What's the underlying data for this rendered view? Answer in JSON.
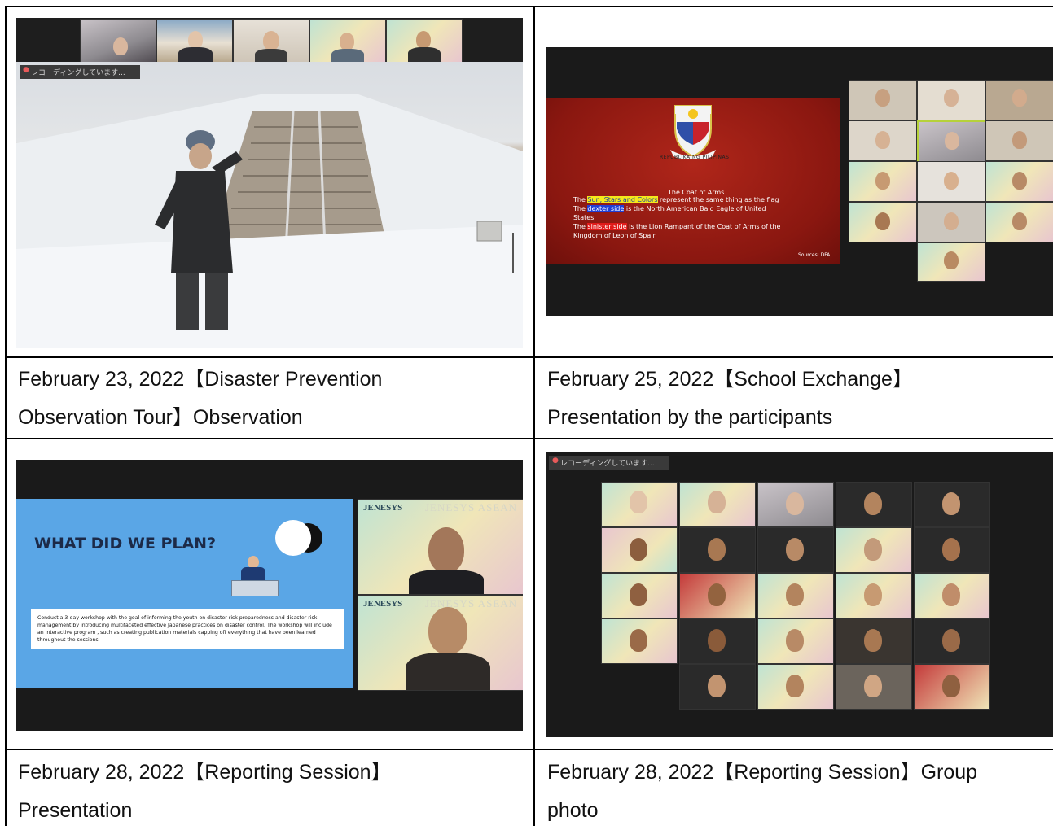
{
  "captions": {
    "c1_line1": "February 23, 2022【Disaster Prevention",
    "c1_line2": "Observation Tour】Observation",
    "c2_line1": "February 25, 2022【School Exchange】",
    "c2_line2": "Presentation by the participants",
    "c3_line1": "February 28, 2022【Reporting Session】",
    "c3_line2": "Presentation",
    "c4_line1": "February 28, 2022【Reporting Session】Group",
    "c4_line2": "photo"
  },
  "recording_label": "レコーディングしています...",
  "coat_of_arms_slide": {
    "ribbon": "REPUBLIKA NG PILIPINAS",
    "title": "The Coat of Arms",
    "line1_pre": "The ",
    "line1_hl": "Sun, Stars and Colors",
    "line1_post": " represent the same thing as the flag",
    "line2_pre": "The ",
    "line2_hl": "dexter side",
    "line2_post": " is the North American Bald Eagle of United",
    "line3": "States",
    "line4_pre": "The ",
    "line4_hl": "sinister side",
    "line4_post": " is the Lion Rampant of the Coat of Arms of the",
    "line5": "Kingdom of Leon of Spain",
    "source": "Sources: DFA"
  },
  "plan_slide": {
    "title": "WHAT DID WE PLAN?",
    "body": "Conduct a 3-day workshop with the goal of informing the youth on disaster risk preparedness and disaster risk management by introducing multifaceted effective Japanese practices on disaster control. The workshop will include an interactive program , such as creating publication materials capping off everything that have been learned throughout the sessions."
  },
  "jenesys": {
    "brand": "JENESYS",
    "asean": "JENESYS ASEAN"
  },
  "colors": {
    "zoom_bg": "#1a1a1a",
    "slide_red": "#9b1c14",
    "slide_blue": "#5aa6e6",
    "grid_line": "#000000"
  }
}
